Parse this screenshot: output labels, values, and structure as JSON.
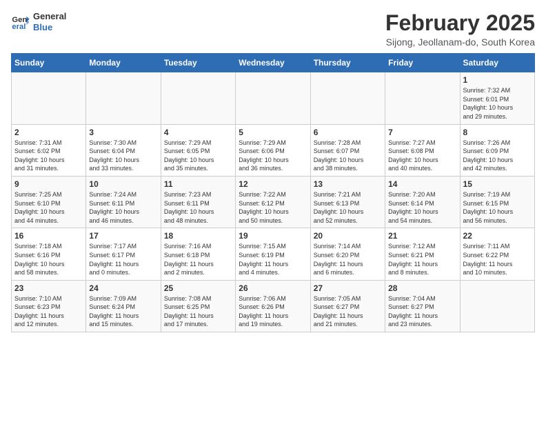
{
  "header": {
    "logo_line1": "General",
    "logo_line2": "Blue",
    "month": "February 2025",
    "location": "Sijong, Jeollanam-do, South Korea"
  },
  "weekdays": [
    "Sunday",
    "Monday",
    "Tuesday",
    "Wednesday",
    "Thursday",
    "Friday",
    "Saturday"
  ],
  "weeks": [
    [
      {
        "day": "",
        "info": ""
      },
      {
        "day": "",
        "info": ""
      },
      {
        "day": "",
        "info": ""
      },
      {
        "day": "",
        "info": ""
      },
      {
        "day": "",
        "info": ""
      },
      {
        "day": "",
        "info": ""
      },
      {
        "day": "1",
        "info": "Sunrise: 7:32 AM\nSunset: 6:01 PM\nDaylight: 10 hours\nand 29 minutes."
      }
    ],
    [
      {
        "day": "2",
        "info": "Sunrise: 7:31 AM\nSunset: 6:02 PM\nDaylight: 10 hours\nand 31 minutes."
      },
      {
        "day": "3",
        "info": "Sunrise: 7:30 AM\nSunset: 6:04 PM\nDaylight: 10 hours\nand 33 minutes."
      },
      {
        "day": "4",
        "info": "Sunrise: 7:29 AM\nSunset: 6:05 PM\nDaylight: 10 hours\nand 35 minutes."
      },
      {
        "day": "5",
        "info": "Sunrise: 7:29 AM\nSunset: 6:06 PM\nDaylight: 10 hours\nand 36 minutes."
      },
      {
        "day": "6",
        "info": "Sunrise: 7:28 AM\nSunset: 6:07 PM\nDaylight: 10 hours\nand 38 minutes."
      },
      {
        "day": "7",
        "info": "Sunrise: 7:27 AM\nSunset: 6:08 PM\nDaylight: 10 hours\nand 40 minutes."
      },
      {
        "day": "8",
        "info": "Sunrise: 7:26 AM\nSunset: 6:09 PM\nDaylight: 10 hours\nand 42 minutes."
      }
    ],
    [
      {
        "day": "9",
        "info": "Sunrise: 7:25 AM\nSunset: 6:10 PM\nDaylight: 10 hours\nand 44 minutes."
      },
      {
        "day": "10",
        "info": "Sunrise: 7:24 AM\nSunset: 6:11 PM\nDaylight: 10 hours\nand 46 minutes."
      },
      {
        "day": "11",
        "info": "Sunrise: 7:23 AM\nSunset: 6:11 PM\nDaylight: 10 hours\nand 48 minutes."
      },
      {
        "day": "12",
        "info": "Sunrise: 7:22 AM\nSunset: 6:12 PM\nDaylight: 10 hours\nand 50 minutes."
      },
      {
        "day": "13",
        "info": "Sunrise: 7:21 AM\nSunset: 6:13 PM\nDaylight: 10 hours\nand 52 minutes."
      },
      {
        "day": "14",
        "info": "Sunrise: 7:20 AM\nSunset: 6:14 PM\nDaylight: 10 hours\nand 54 minutes."
      },
      {
        "day": "15",
        "info": "Sunrise: 7:19 AM\nSunset: 6:15 PM\nDaylight: 10 hours\nand 56 minutes."
      }
    ],
    [
      {
        "day": "16",
        "info": "Sunrise: 7:18 AM\nSunset: 6:16 PM\nDaylight: 10 hours\nand 58 minutes."
      },
      {
        "day": "17",
        "info": "Sunrise: 7:17 AM\nSunset: 6:17 PM\nDaylight: 11 hours\nand 0 minutes."
      },
      {
        "day": "18",
        "info": "Sunrise: 7:16 AM\nSunset: 6:18 PM\nDaylight: 11 hours\nand 2 minutes."
      },
      {
        "day": "19",
        "info": "Sunrise: 7:15 AM\nSunset: 6:19 PM\nDaylight: 11 hours\nand 4 minutes."
      },
      {
        "day": "20",
        "info": "Sunrise: 7:14 AM\nSunset: 6:20 PM\nDaylight: 11 hours\nand 6 minutes."
      },
      {
        "day": "21",
        "info": "Sunrise: 7:12 AM\nSunset: 6:21 PM\nDaylight: 11 hours\nand 8 minutes."
      },
      {
        "day": "22",
        "info": "Sunrise: 7:11 AM\nSunset: 6:22 PM\nDaylight: 11 hours\nand 10 minutes."
      }
    ],
    [
      {
        "day": "23",
        "info": "Sunrise: 7:10 AM\nSunset: 6:23 PM\nDaylight: 11 hours\nand 12 minutes."
      },
      {
        "day": "24",
        "info": "Sunrise: 7:09 AM\nSunset: 6:24 PM\nDaylight: 11 hours\nand 15 minutes."
      },
      {
        "day": "25",
        "info": "Sunrise: 7:08 AM\nSunset: 6:25 PM\nDaylight: 11 hours\nand 17 minutes."
      },
      {
        "day": "26",
        "info": "Sunrise: 7:06 AM\nSunset: 6:26 PM\nDaylight: 11 hours\nand 19 minutes."
      },
      {
        "day": "27",
        "info": "Sunrise: 7:05 AM\nSunset: 6:27 PM\nDaylight: 11 hours\nand 21 minutes."
      },
      {
        "day": "28",
        "info": "Sunrise: 7:04 AM\nSunset: 6:27 PM\nDaylight: 11 hours\nand 23 minutes."
      },
      {
        "day": "",
        "info": ""
      }
    ]
  ]
}
